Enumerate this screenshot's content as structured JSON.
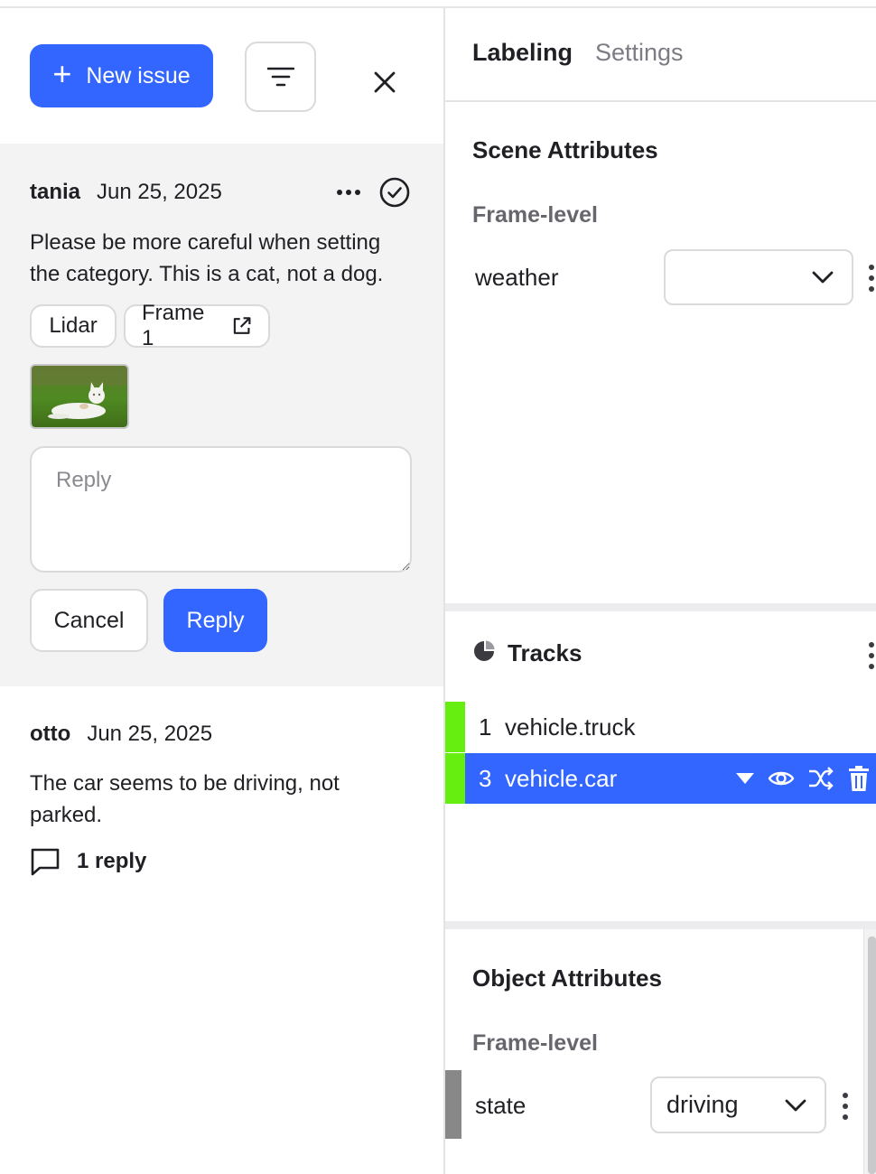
{
  "left_panel": {
    "new_issue_label": "New issue",
    "issues": [
      {
        "author": "tania",
        "date": "Jun 25, 2025",
        "text": "Please be more careful when setting the category. This is a cat, not a dog.",
        "chips": {
          "sensor": "Lidar",
          "frame": "Frame 1"
        },
        "reply_placeholder": "Reply",
        "cancel_label": "Cancel",
        "reply_label": "Reply"
      },
      {
        "author": "otto",
        "date": "Jun 25, 2025",
        "text": "The car seems to be driving, not parked.",
        "replies_label": "1 reply"
      }
    ]
  },
  "right_panel": {
    "tabs": [
      {
        "label": "Labeling",
        "active": true
      },
      {
        "label": "Settings",
        "active": false
      }
    ],
    "scene_attributes": {
      "title": "Scene Attributes",
      "subtitle": "Frame-level",
      "attributes": [
        {
          "name": "weather",
          "value": ""
        }
      ]
    },
    "tracks": {
      "title": "Tracks",
      "items": [
        {
          "id": "1",
          "name": "vehicle.truck",
          "color": "#66ee11",
          "selected": false
        },
        {
          "id": "3",
          "name": "vehicle.car",
          "color": "#66ee11",
          "selected": true
        }
      ]
    },
    "object_attributes": {
      "title": "Object Attributes",
      "subtitle": "Frame-level",
      "attributes": [
        {
          "name": "state",
          "value": "driving"
        }
      ]
    }
  },
  "colors": {
    "primary": "#3366ff",
    "track_green": "#66ee11",
    "panel_gray": "#f3f3f4"
  },
  "icons": [
    "plus-icon",
    "filter-icon",
    "close-icon",
    "more-icon",
    "resolve-check-icon",
    "external-link-icon",
    "comment-icon",
    "chevron-down-icon",
    "kebab-icon",
    "pie-chart-icon",
    "caret-down-icon",
    "eye-icon",
    "shuffle-icon",
    "trash-icon"
  ]
}
